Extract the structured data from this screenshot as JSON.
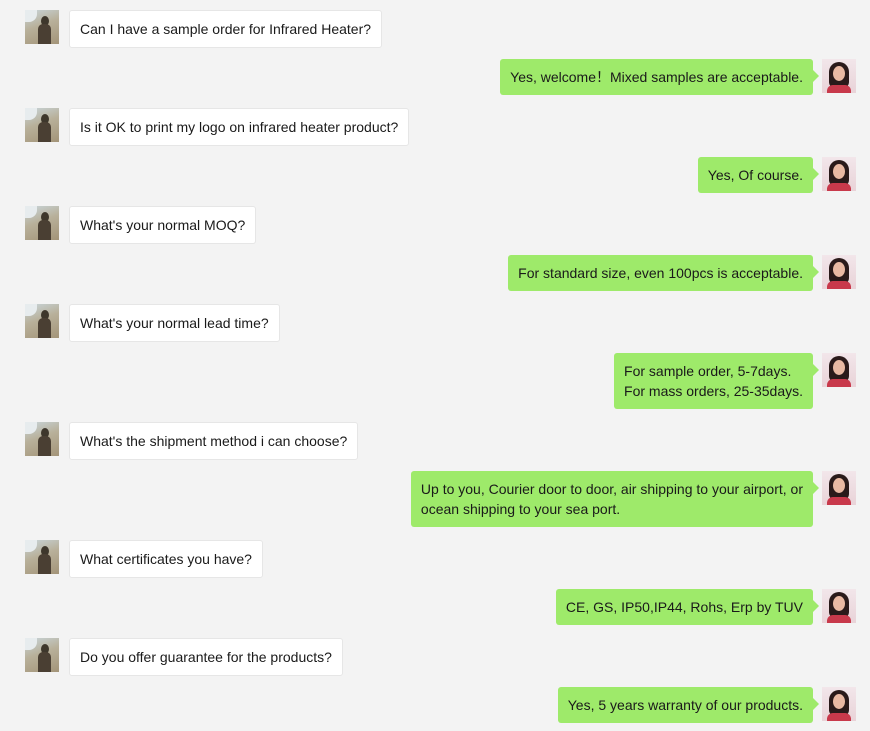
{
  "messages": [
    {
      "side": "left",
      "lines": [
        "Can I have a sample order for Infrared Heater?"
      ]
    },
    {
      "side": "right",
      "lines": [
        "Yes, welcome！Mixed samples are acceptable."
      ]
    },
    {
      "side": "left",
      "lines": [
        "Is it OK to print my logo on infrared heater product?"
      ]
    },
    {
      "side": "right",
      "lines": [
        "Yes, Of course."
      ]
    },
    {
      "side": "left",
      "lines": [
        "What's your normal MOQ?"
      ]
    },
    {
      "side": "right",
      "lines": [
        "For standard size, even 100pcs is acceptable."
      ]
    },
    {
      "side": "left",
      "lines": [
        "What's your normal lead time?"
      ]
    },
    {
      "side": "right",
      "lines": [
        "For sample order, 5-7days.",
        "For mass orders, 25-35days."
      ]
    },
    {
      "side": "left",
      "lines": [
        "What's the shipment method i can choose?"
      ]
    },
    {
      "side": "right",
      "lines": [
        "Up to you, Courier door to door, air shipping to your airport, or",
        "ocean shipping to your sea port."
      ]
    },
    {
      "side": "left",
      "lines": [
        "What certificates you have?"
      ]
    },
    {
      "side": "right",
      "lines": [
        "CE, GS, IP50,IP44, Rohs, Erp by TUV"
      ]
    },
    {
      "side": "left",
      "lines": [
        "Do you offer guarantee for the products?"
      ]
    },
    {
      "side": "right",
      "lines": [
        "Yes,  5 years warranty of our products."
      ]
    }
  ]
}
